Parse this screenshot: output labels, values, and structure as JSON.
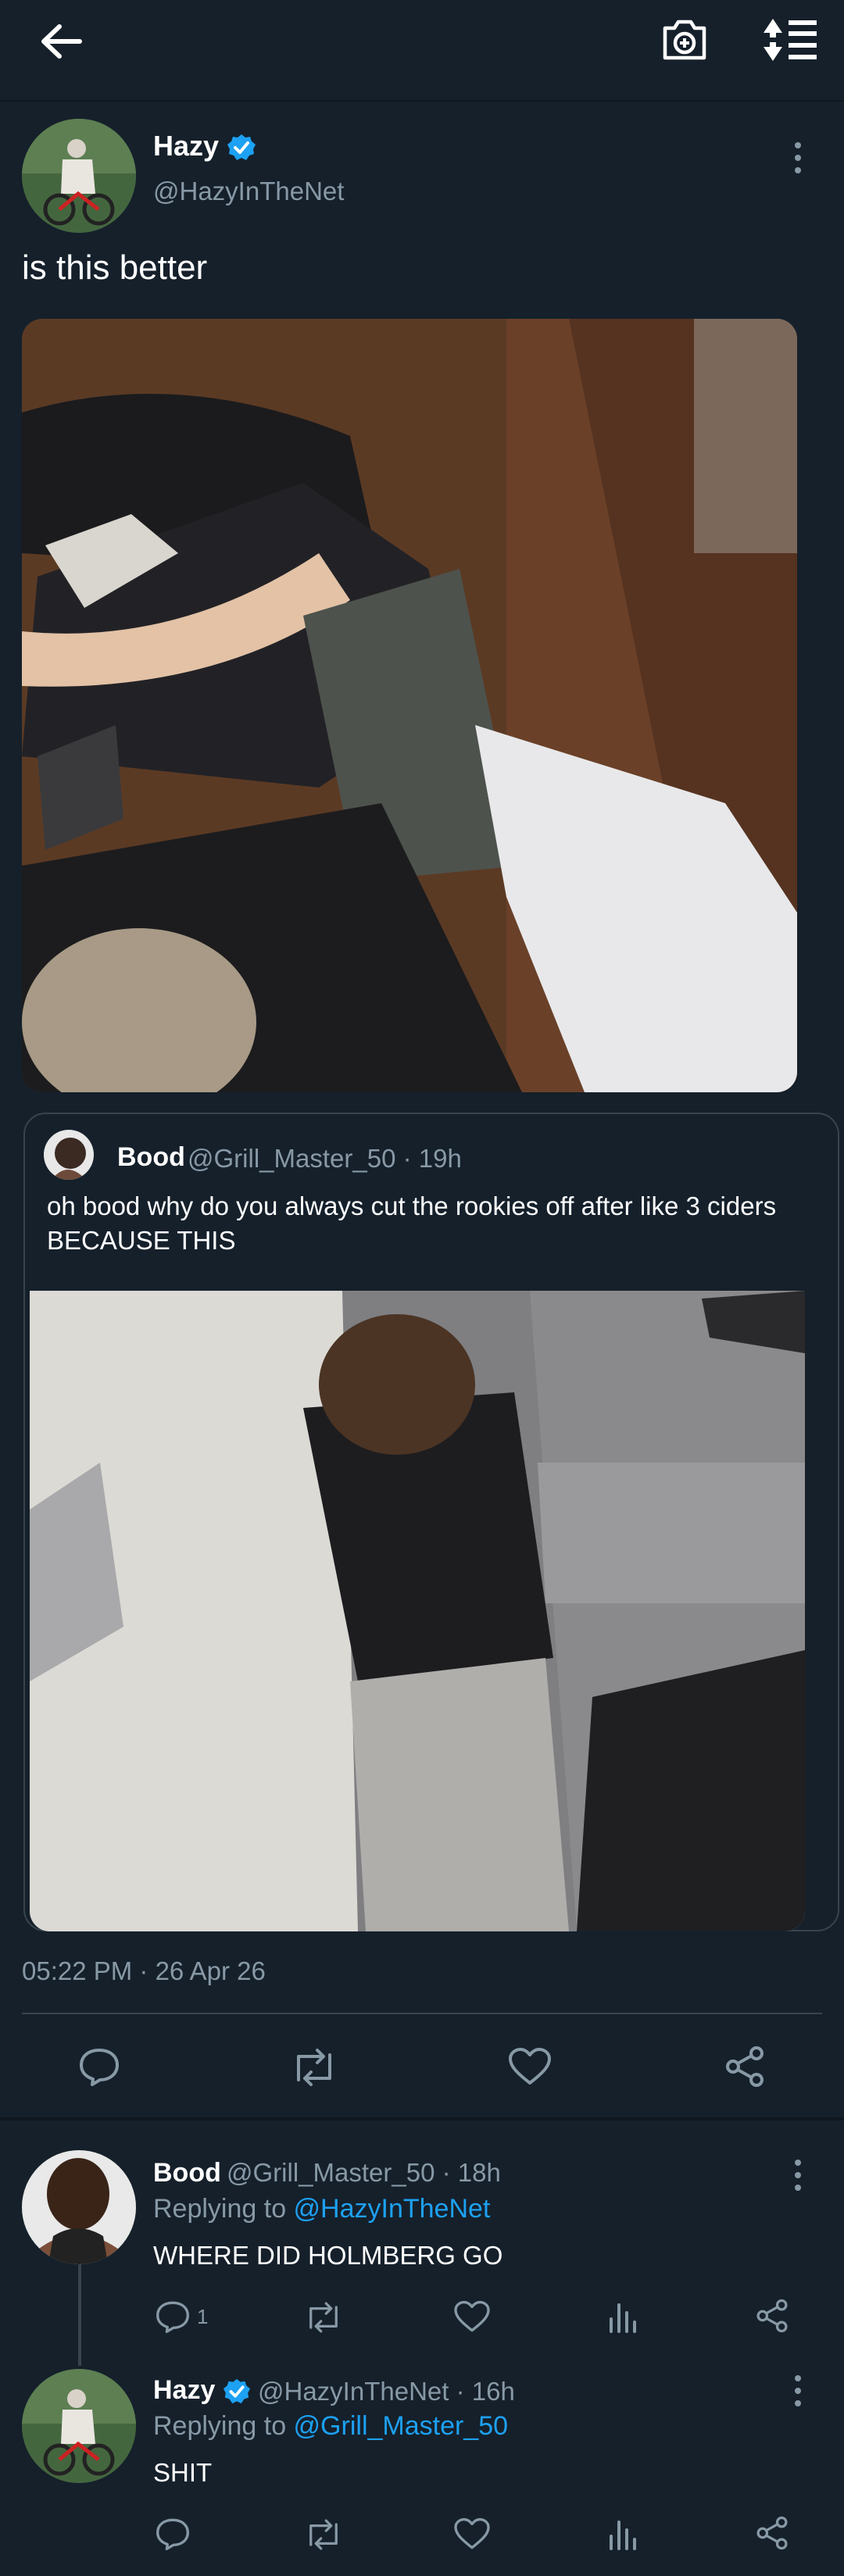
{
  "topbar": {
    "back_icon": "arrow-left-icon",
    "camera_icon": "camera-plus-icon",
    "sort_icon": "sort-arrows-icon"
  },
  "main_tweet": {
    "author_name": "Hazy",
    "author_handle": "@HazyInTheNet",
    "text": "is this better",
    "image_desc_icon": "photo",
    "timestamp": "05:22 PM · 26 Apr 26",
    "quote": {
      "author_name": "Bood",
      "meta": "@Grill_Master_50 · 19h",
      "text": "oh bood why do you always cut the rookies off after like 3 ciders BECAUSE THIS"
    }
  },
  "replies": [
    {
      "author_name": "Bood",
      "meta": "@Grill_Master_50 · 18h",
      "replying_prefix": "Replying to ",
      "replying_to": "@HazyInTheNet",
      "text": "WHERE DID HOLMBERG GO",
      "reply_count": "1"
    },
    {
      "author_name": "Hazy",
      "meta": "@HazyInTheNet · 16h",
      "replying_prefix": "Replying to ",
      "replying_to": "@Grill_Master_50",
      "text": "SHIT",
      "reply_count": ""
    }
  ],
  "colors": {
    "background": "#15202b",
    "secondary_text": "#8899a6",
    "link": "#1da1f2",
    "divider": "#38444d"
  }
}
